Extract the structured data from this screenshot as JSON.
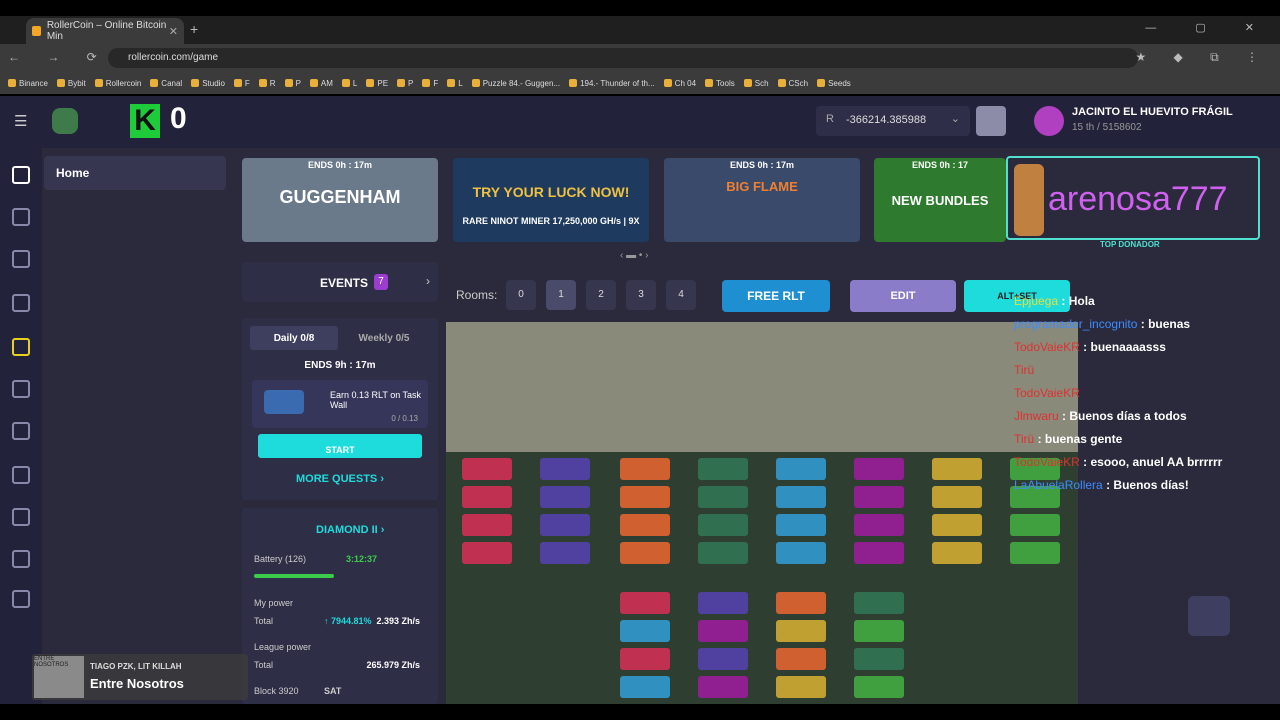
{
  "browser": {
    "tab_title": "RollerCoin – Online Bitcoin Min",
    "url": "rollercoin.com/game",
    "bookmarks": [
      "Binance",
      "Bybit",
      "Rollercoin",
      "Canal",
      "Studio",
      "F",
      "R",
      "P",
      "AM",
      "L",
      "PE",
      "P",
      "F",
      "L",
      "Puzzle 84.- Guggen...",
      "194.- Thunder of th...",
      "Ch 04",
      "Tools",
      "Sch",
      "CSch",
      "Seeds"
    ]
  },
  "topbar": {
    "k_count": "0",
    "balance": "-366214.385988",
    "balance_symbol": "R",
    "user_name": "JACINTO EL HUEVITO FRÁGIL",
    "user_rank": "15 th / 5158602"
  },
  "sidebar": {
    "home_label": "Home"
  },
  "banners": [
    {
      "ends": "ENDS  0h : 17m",
      "title": "GUGGENHAM",
      "color": "#6a7a8a"
    },
    {
      "ends": "",
      "title": "TRY YOUR LUCK NOW!",
      "sub": "RARE NINOT MINER 17,250,000 GH/s | 9X",
      "color": "#1e3a5e"
    },
    {
      "ends": "ENDS  0h : 17m",
      "title": "BIG FLAME",
      "color": "#3a4a6a"
    },
    {
      "ends": "ENDS  0h : 17",
      "title": "NEW BUNDLES",
      "color": "#2e7a2e"
    }
  ],
  "donor": {
    "name": "arenosa777",
    "label": "TOP DONADOR"
  },
  "events": {
    "label": "EVENTS",
    "count": "7"
  },
  "quests": {
    "daily": "Daily  0/8",
    "weekly": "Weekly  0/5",
    "ends": "ENDS  9h : 17m",
    "task": "Earn 0.13 RLT on Task Wall",
    "progress": "0 / 0.13",
    "start": "START",
    "more": "MORE QUESTS  ›"
  },
  "league": {
    "name": "DIAMOND II  ›",
    "battery_label": "Battery (126)",
    "battery_time": "3:12:37",
    "my_power": "My power",
    "total": "Total",
    "power_change": "↑ 7944.81%",
    "power_value": "2.393 Zh/s",
    "league_power": "League power",
    "league_total": "265.979 Zh/s",
    "block": "Block 3920",
    "block_unit": "SAT"
  },
  "rooms": {
    "label": "Rooms:",
    "numbers": [
      "0",
      "1",
      "2",
      "3",
      "4"
    ],
    "selected": "1",
    "free_rlt": "FREE RLT",
    "edit": "EDIT",
    "alt": "ALT+SET"
  },
  "chat": [
    {
      "user": "Epjuega",
      "color": "#e0e040",
      "msg": "Hola"
    },
    {
      "user": "programador_incognito",
      "color": "#3c8cff",
      "msg": "buenas"
    },
    {
      "user": "TodoVaieKR",
      "color": "#e03030",
      "msg": "buenaaaasss"
    },
    {
      "user": "Tirü",
      "color": "#e03030",
      "msg": ""
    },
    {
      "user": "TodoVaieKR",
      "color": "#e03030",
      "msg": ""
    },
    {
      "user": "Jlmwaru",
      "color": "#e03030",
      "msg": "Buenos días a todos"
    },
    {
      "user": "Tirü",
      "color": "#e03030",
      "msg": "buenas gente"
    },
    {
      "user": "TodoVaieKR",
      "color": "#e03030",
      "msg": "esooo, anuel AA brrrrrr"
    },
    {
      "user": "LaAbuelaRollera",
      "color": "#3c8cff",
      "msg": "Buenos días!"
    }
  ],
  "music": {
    "artist": "TIAGO PZK, LIT KILLAH",
    "song": "Entre Nosotros",
    "art_text": "ENTRE NOSOTROS"
  }
}
